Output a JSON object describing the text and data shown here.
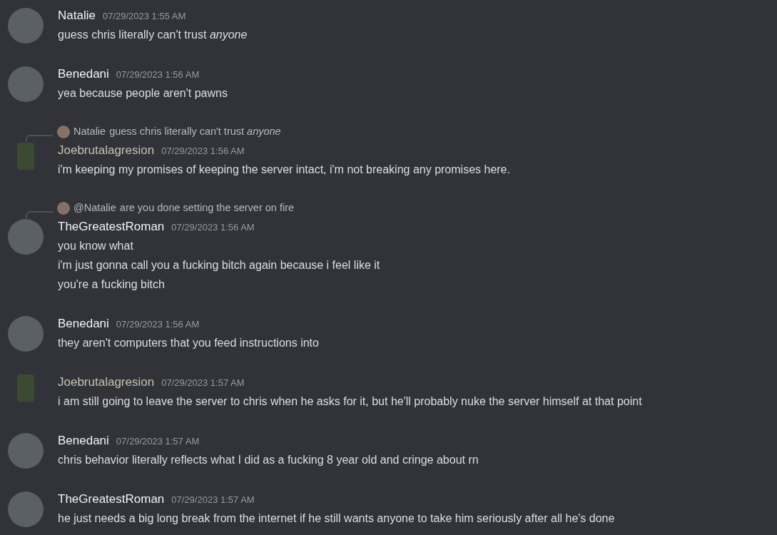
{
  "messages": [
    {
      "author": "Natalie",
      "color": "#f2f3f5",
      "avatar": {
        "kind": "round"
      },
      "timestamp": "07/29/2023 1:55 AM",
      "lines": [
        "guess chris literally can't trust *anyone*"
      ]
    },
    {
      "author": "Benedani",
      "color": "#f2f3f5",
      "avatar": {
        "kind": "round"
      },
      "timestamp": "07/29/2023 1:56 AM",
      "lines": [
        "yea because people aren't pawns"
      ]
    },
    {
      "author": "Joebrutalagresion",
      "color": "#c7c1b3",
      "avatar": {
        "kind": "sprite"
      },
      "timestamp": "07/29/2023 1:56 AM",
      "reply": {
        "author": "Natalie",
        "text": "guess chris literally can't trust *anyone*"
      },
      "lines": [
        "i'm keeping my promises of keeping the server intact, i'm not breaking any promises here."
      ]
    },
    {
      "author": "TheGreatestRoman",
      "color": "#f2f3f5",
      "avatar": {
        "kind": "round"
      },
      "timestamp": "07/29/2023 1:56 AM",
      "reply": {
        "author": "@Natalie",
        "text": "are you done setting the server on fire"
      },
      "lines": [
        "you know what",
        "i'm just gonna call you a fucking bitch again because i feel like it",
        "you're a fucking bitch"
      ]
    },
    {
      "author": "Benedani",
      "color": "#f2f3f5",
      "avatar": {
        "kind": "round"
      },
      "timestamp": "07/29/2023 1:56 AM",
      "lines": [
        "they aren't computers that you feed instructions into"
      ]
    },
    {
      "author": "Joebrutalagresion",
      "color": "#c7c1b3",
      "avatar": {
        "kind": "sprite"
      },
      "timestamp": "07/29/2023 1:57 AM",
      "lines": [
        "i am still going to leave the server to chris when he asks for it, but he'll probably nuke the server himself at that point"
      ]
    },
    {
      "author": "Benedani",
      "color": "#f2f3f5",
      "avatar": {
        "kind": "round"
      },
      "timestamp": "07/29/2023 1:57 AM",
      "lines": [
        "chris behavior literally reflects what I did as a fucking 8 year old and cringe about rn"
      ]
    },
    {
      "author": "TheGreatestRoman",
      "color": "#f2f3f5",
      "avatar": {
        "kind": "round"
      },
      "timestamp": "07/29/2023 1:57 AM",
      "lines": [
        "he just needs a big long break from the internet if he still wants anyone to take him seriously after all he's done"
      ]
    }
  ]
}
